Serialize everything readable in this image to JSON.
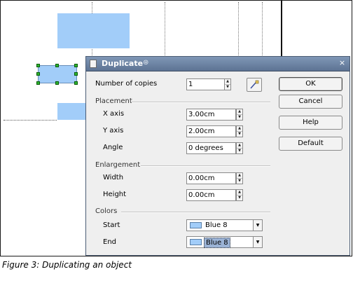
{
  "caption": "Figure 3: Duplicating an object",
  "dialog": {
    "title": "Duplicate",
    "close_glyph": "×",
    "number_of_copies": {
      "label": "Number of copies",
      "value": "1"
    },
    "placement": {
      "section": "Placement",
      "x_axis": {
        "label": "X axis",
        "value": "3.00cm"
      },
      "y_axis": {
        "label": "Y axis",
        "value": "2.00cm"
      },
      "angle": {
        "label": "Angle",
        "value": "0 degrees"
      }
    },
    "enlargement": {
      "section": "Enlargement",
      "width": {
        "label": "Width",
        "value": "0.00cm"
      },
      "height": {
        "label": "Height",
        "value": "0.00cm"
      }
    },
    "colors": {
      "section": "Colors",
      "start": {
        "label": "Start",
        "value": "Blue 8"
      },
      "end": {
        "label": "End",
        "value": "Blue 8"
      }
    },
    "buttons": {
      "ok": "OK",
      "cancel": "Cancel",
      "help": "Help",
      "default": "Default"
    }
  },
  "icons": {
    "spin_up": "▲",
    "spin_down": "▼",
    "dropdown": "▼",
    "pin": "⊛"
  },
  "colors": {
    "shape_fill": "#a2cdf9",
    "titlebar": "#6b82a3",
    "handle": "#2db52d"
  }
}
